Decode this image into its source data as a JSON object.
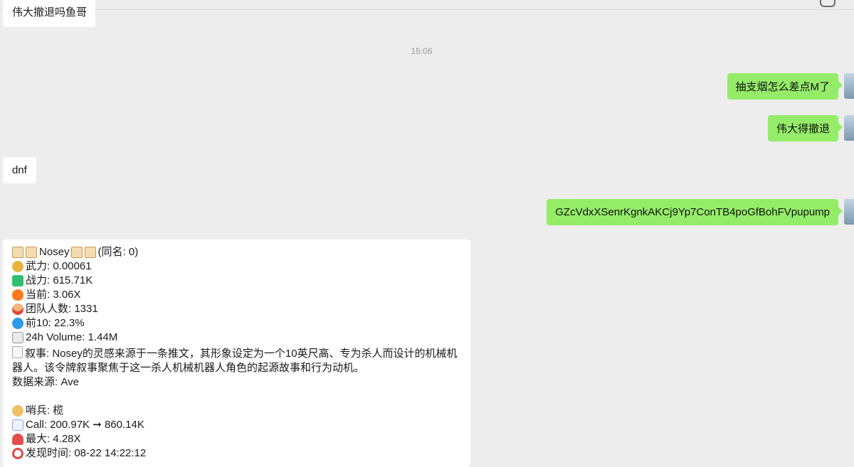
{
  "messages": {
    "m1": "伟大撤退吗鱼哥",
    "time": "15:06",
    "m2": "抽支烟怎么差点M了",
    "m3": "伟大得撤退",
    "m4": "dnf",
    "m5": "GZcVdxXSenrKgnkAKCj9Yp7ConTB4poGfBohFVpupump"
  },
  "card": {
    "l1": "Nosey",
    "l1b": "(同名: 0)",
    "l2": "武力: 0.00061",
    "l3": "战力: 615.71K",
    "l4": "当前: 3.06X",
    "l5": "团队人数: 1331",
    "l6": "前10: 22.3%",
    "l7": "24h Volume: 1.44M",
    "l8": "叙事: Nosey的灵感来源于一条推文，其形象设定为一个10英尺高、专为杀人而设计的机械机器人。该令牌叙事聚焦于这一杀人机械机器人角色的起源故事和行为动机。",
    "l9": "数据来源: Ave",
    "l10": "哨兵: 榄",
    "l11": "Call: 200.97K ➞ 860.14K",
    "l12": "最大: 4.28X",
    "l13": "发现时间: 08-22 14:22:12"
  },
  "colors": {
    "bg": "#ededed",
    "self_bubble": "#95ec69",
    "other_bubble": "#ffffff"
  }
}
